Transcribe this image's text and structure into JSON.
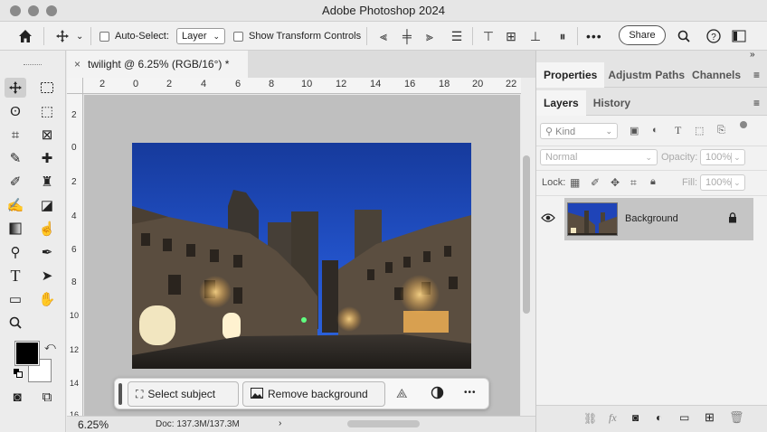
{
  "app": {
    "title": "Adobe Photoshop 2024"
  },
  "options_bar": {
    "auto_select_label": "Auto-Select:",
    "auto_select_value": "Layer",
    "show_transform_label": "Show Transform Controls",
    "share_label": "Share"
  },
  "document": {
    "tab_title": "twilight @ 6.25% (RGB/16°) *",
    "close_glyph": "×",
    "zoom": "6.25%",
    "doc_info": "Doc: 137.3M/137.3M"
  },
  "rulers": {
    "horizontal": [
      "2",
      "0",
      "2",
      "4",
      "6",
      "8",
      "10",
      "12",
      "14",
      "16",
      "18",
      "20",
      "22"
    ],
    "vertical": [
      "2",
      "0",
      "2",
      "4",
      "6",
      "8",
      "10",
      "12",
      "14",
      "16"
    ]
  },
  "contextual_bar": {
    "select_subject": "Select subject",
    "remove_background": "Remove background",
    "more": "•••"
  },
  "panels": {
    "top_tabs": [
      "Properties",
      "Adjustm",
      "Paths",
      "Channels"
    ],
    "layer_tabs": [
      "Layers",
      "History"
    ],
    "filter_kind": "Kind",
    "blend_mode": "Normal",
    "opacity_label": "Opacity:",
    "opacity_value": "100%",
    "lock_label": "Lock:",
    "fill_label": "Fill:",
    "fill_value": "100%",
    "layers": [
      {
        "name": "Background",
        "visible": true,
        "locked": true
      }
    ],
    "footer_fx": "fx"
  },
  "colors": {
    "foreground": "#000000",
    "background": "#ffffff",
    "sky": "#1f44b8"
  }
}
